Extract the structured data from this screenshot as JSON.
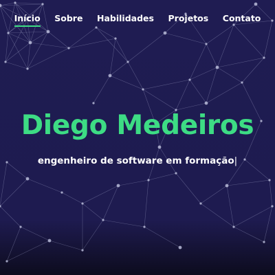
{
  "nav": {
    "items": [
      {
        "label": "Início",
        "active": true
      },
      {
        "label": "Sobre",
        "active": false
      },
      {
        "label": "Habilidades",
        "active": false
      },
      {
        "label": "Projetos",
        "active": false
      },
      {
        "label": "Contato",
        "active": false
      }
    ]
  },
  "hero": {
    "title": "Diego Medeiros",
    "subtitle": "engenheiro de software em formação",
    "cursor": "|"
  },
  "colors": {
    "background": "#1f1c52",
    "accent": "#3ddc84",
    "text": "#ffffff",
    "network_lines": "#9a9cc0"
  }
}
